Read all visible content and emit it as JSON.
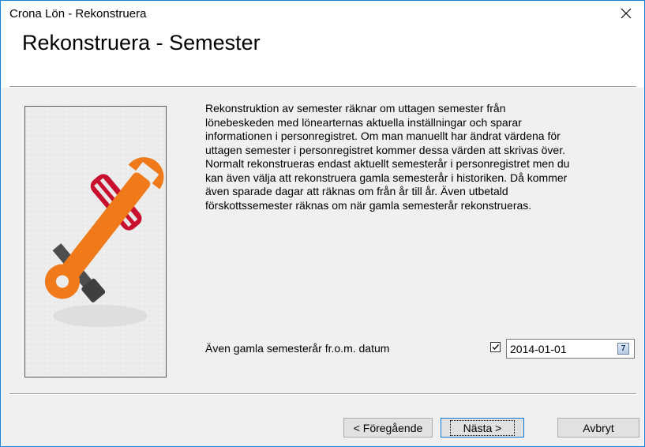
{
  "window": {
    "title": "Crona Lön - Rekonstruera",
    "close_icon": "close-icon"
  },
  "page": {
    "title": "Rekonstruera - Semester"
  },
  "description": "Rekonstruktion av semester räknar om uttagen semester från\nlönebeskeden med lönearternas aktuella inställningar och sparar\ninformationen i personregistret. Om man manuellt har ändrat värdena för\nuttagen semester i personregistret kommer dessa värden att skrivas över.\nNormalt rekonstrueras endast aktuellt semesterår i personregistret men du\nkan även välja att rekonstruera gamla semesterår i historiken. Då kommer\näven sparade dagar att räknas om från år till år. Även utbetald\nförskottssemester räknas om när gamla semesterår rekonstrueras.",
  "option": {
    "label": "Även gamla semesterår fr.o.m. datum",
    "checked": true,
    "date_value": "2014-01-01",
    "calendar_icon_glyph": "7"
  },
  "buttons": {
    "previous": "< Föregående",
    "next": "Nästa >",
    "cancel": "Avbryt"
  },
  "colors": {
    "window_border": "#1883d7",
    "panel_bg": "#f0f0f0",
    "wrench_orange": "#f07a1a",
    "screwdriver_red": "#c8102e"
  }
}
